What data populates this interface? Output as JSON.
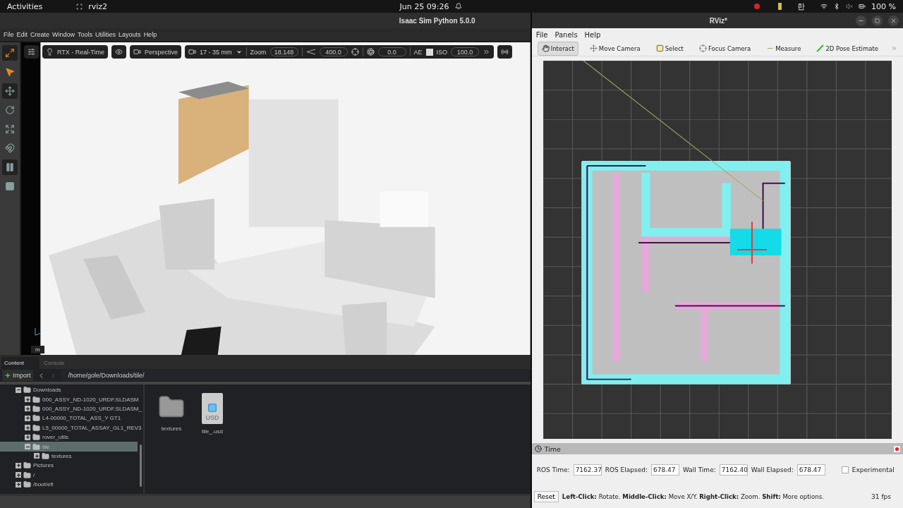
{
  "top_bar": {
    "activities": "Activities",
    "app": "rviz2",
    "clock": "Jun 25  09:26",
    "ime": "한",
    "battery": "100 %"
  },
  "isaac": {
    "title": "Isaac Sim Python 5.0.0",
    "menu": [
      "File",
      "Edit",
      "Create",
      "Window",
      "Tools",
      "Utilities",
      "Layouts",
      "Help"
    ],
    "viewport_toolbar": {
      "renderer": "RTX - Real-Time",
      "camera": "Perspective",
      "lens": "17 - 35 mm",
      "zoom_label": "Zoom",
      "zoom": "18.148",
      "far": "400.0",
      "exposure": "0.0",
      "ae_label": "AE",
      "ae_checked": false,
      "iso_label": "ISO",
      "iso": "100.0"
    },
    "units": "m",
    "content": {
      "tabs": [
        {
          "label": "Content",
          "selected": true
        },
        {
          "label": "Console",
          "selected": false
        }
      ],
      "import": "Import",
      "path": "/home/gole/Downloads/tile/",
      "tree": [
        {
          "label": "Downloads",
          "expanded": true,
          "selected": false,
          "children": [
            {
              "label": "000_ASSY_ND-1020_URDF.SLDASM",
              "expanded": false,
              "selected": false
            },
            {
              "label": "000_ASSY_ND-1020_URDF.SLDASM_",
              "expanded": false,
              "selected": false
            },
            {
              "label": "L4-00000_TOTAL_ASS_Y GT1",
              "expanded": false,
              "selected": false
            },
            {
              "label": "L5_00000_TOTAL_ASSAY_GL1_REV3",
              "expanded": false,
              "selected": false
            },
            {
              "label": "rover_utils",
              "expanded": false,
              "selected": false
            },
            {
              "label": "tile",
              "expanded": true,
              "selected": true,
              "children": [
                {
                  "label": "textures",
                  "expanded": false,
                  "selected": false
                }
              ]
            }
          ]
        },
        {
          "label": "Pictures",
          "expanded": false,
          "selected": false
        },
        {
          "label": "/",
          "expanded": false,
          "selected": false
        },
        {
          "label": "/boot/efi",
          "expanded": false,
          "selected": false
        }
      ],
      "files": [
        {
          "name": "textures",
          "kind": "folder"
        },
        {
          "name": "tile_.usd",
          "kind": "usd",
          "badge": "USD"
        }
      ]
    }
  },
  "rviz": {
    "title": "RViz*",
    "menu": [
      "File",
      "Panels",
      "Help"
    ],
    "tools": [
      {
        "label": "Interact",
        "kind": "interact",
        "selected": true
      },
      {
        "label": "Move Camera",
        "kind": "move",
        "selected": false
      },
      {
        "label": "Select",
        "kind": "select",
        "selected": false
      },
      {
        "label": "Focus Camera",
        "kind": "focus",
        "selected": false
      },
      {
        "label": "Measure",
        "kind": "measure",
        "selected": false
      },
      {
        "label": "2D Pose Estimate",
        "kind": "pose",
        "selected": false
      }
    ],
    "time_panel": {
      "title": "Time",
      "fields": [
        {
          "label": "ROS Time:",
          "value": "7162.37"
        },
        {
          "label": "ROS Elapsed:",
          "value": "678.47"
        },
        {
          "label": "Wall Time:",
          "value": "7162.40"
        },
        {
          "label": "Wall Elapsed:",
          "value": "678.47"
        }
      ],
      "experimental": {
        "label": "Experimental",
        "checked": false
      }
    },
    "status": {
      "reset": "Reset",
      "hint": "**Left-Click:** Rotate. **Middle-Click:** Move X/Y. **Right-Click:** Zoom. **Shift:** More options.",
      "fps": "31 fps"
    }
  }
}
